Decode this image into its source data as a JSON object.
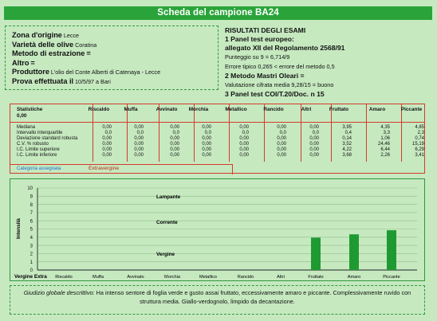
{
  "header": {
    "title": "Scheda del campione BA24"
  },
  "info": {
    "zona_label": "Zona d'origine",
    "zona_value": "Lecce",
    "varieta_label": "Varietà delle olive",
    "varieta_value": "Coratina",
    "metodo_label": "Metodo di estrazione",
    "metodo_value": "=",
    "altro_label": "Altro",
    "altro_value": "=",
    "produttore_label": "Produttore",
    "produttore_value": "L'olio del Conte Alberti di Catenaya - Lecce",
    "prova_label": "Prova effettuata il",
    "prova_value": "10/5/97  a Bari"
  },
  "results": {
    "title": "RISULTATI DEGLI ESAMI",
    "panel1_a": "1 Panel test europeo:",
    "panel1_b": "allegato XII del Regolamento 2568/91",
    "panel1_c": "Punteggio su 9 = 6,714/9",
    "panel1_d": "Errore tipico 0,265 < errore del metodo 0,5",
    "panel2": "2 Metodo Mastri Oleari =",
    "panel2_b": "Valutazione cifrata media 9,28/15 = buono",
    "panel3": "3 Panel test COI/T.20/Doc. n 15"
  },
  "table": {
    "stat_header_1": "Statistiche",
    "stat_header_2": "0,00",
    "columns": [
      "Riscaldo",
      "Muffa",
      "Avvinato",
      "Morchia",
      "Metallico",
      "Rancido",
      "Altri",
      "Fruttato",
      "Amaro",
      "Piccante"
    ],
    "row_labels": [
      "Mediana",
      "Intervallo interquartile",
      "Deviazione standard robusta",
      "C.V. % robusto",
      "I.C. Limite superiore",
      "I.C. Limite inferiore"
    ],
    "rows": [
      [
        "0,00",
        "0,00",
        "0,00",
        "0,00",
        "0,00",
        "0,00",
        "0,00",
        "3,95",
        "4,35",
        "4,85"
      ],
      [
        "0,0",
        "0,0",
        "0,0",
        "0,0",
        "0,0",
        "0,0",
        "0,0",
        "0,4",
        "3,3",
        "2,3"
      ],
      [
        "0,00",
        "0,00",
        "0,00",
        "0,00",
        "0,00",
        "0,00",
        "0,00",
        "0,14",
        "1,06",
        "0,74"
      ],
      [
        "0,00",
        "0,00",
        "0,00",
        "0,00",
        "0,00",
        "0,00",
        "0,00",
        "3,52",
        "24,46",
        "15,19"
      ],
      [
        "0,00",
        "0,00",
        "0,00",
        "0,00",
        "0,00",
        "0,00",
        "0,00",
        "4,22",
        "6,44",
        "6,29"
      ],
      [
        "0,00",
        "0,00",
        "0,00",
        "0,00",
        "0,00",
        "0,00",
        "0,00",
        "3,68",
        "2,26",
        "3,41"
      ]
    ],
    "category_label": "Categoria assegnata",
    "category_value": "Extravergine"
  },
  "chart_data": {
    "type": "bar",
    "categories": [
      "Riscaldo",
      "Muffa",
      "Avvinato",
      "Morchia",
      "Metallico",
      "Rancido",
      "Altri",
      "Fruttato",
      "Amaro",
      "Piccante"
    ],
    "values": [
      0,
      0,
      0,
      0,
      0,
      0,
      0,
      3.95,
      4.35,
      4.85
    ],
    "ylabel": "Intensità",
    "ylim": [
      0,
      10
    ],
    "yticks": [
      0,
      1,
      2,
      3,
      4,
      5,
      6,
      7,
      8,
      9,
      10
    ],
    "bands": [
      "Lampante",
      "Corrente",
      "Vergine",
      "Vergine Extra"
    ],
    "bar_color": "#1f9a32",
    "grid": true
  },
  "footer": {
    "lead": "Giudizio globale descrittivo:",
    "text": "Ha intenso sentore di foglia verde e gusto assai fruttato, eccessivamente amaro e piccante. Complessivamente ruvido con struttura media. Giallo-verdognolo, limpido da decantazione."
  }
}
